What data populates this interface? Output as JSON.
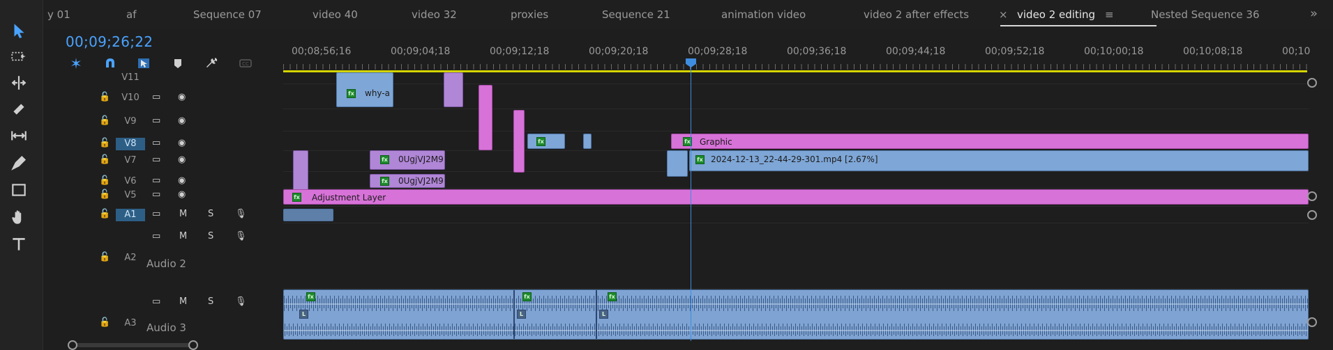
{
  "tabs": [
    {
      "label": "y 01"
    },
    {
      "label": "af"
    },
    {
      "label": "Sequence 07"
    },
    {
      "label": "video 40"
    },
    {
      "label": "video 32"
    },
    {
      "label": "proxies"
    },
    {
      "label": "Sequence 21"
    },
    {
      "label": "animation video"
    },
    {
      "label": "video 2 after effects"
    },
    {
      "label": "video 2 editing",
      "active": true
    },
    {
      "label": "Nested Sequence 36"
    }
  ],
  "active_tab_close": "×",
  "active_tab_menu": "≡",
  "overflow_glyph": "»",
  "timecode": "00;09;26;22",
  "ruler_labels": [
    "00;08;56;16",
    "00;09;04;18",
    "00;09;12;18",
    "00;09;20;18",
    "00;09;28;18",
    "00;09;36;18",
    "00;09;44;18",
    "00;09;52;18",
    "00;10;00;18",
    "00;10;08;18",
    "00;10"
  ],
  "tracks": {
    "v11": {
      "name": "V11"
    },
    "v10": {
      "name": "V10"
    },
    "v9": {
      "name": "V9"
    },
    "v8": {
      "name": "V8"
    },
    "v7": {
      "name": "V7"
    },
    "v6": {
      "name": "V6"
    },
    "v5": {
      "name": "V5"
    },
    "a1": {
      "name": "A1"
    },
    "a2": {
      "name": "A2",
      "label": "Audio 2"
    },
    "a3": {
      "name": "A3",
      "label": "Audio 3"
    }
  },
  "glyphs": {
    "lock": "🔓",
    "mute": "M",
    "solo": "S",
    "fx": "fx",
    "lmark": "L"
  },
  "clips": {
    "why": "why-a",
    "ougj1": "0UgjVJ2M9",
    "ougj2": "0UgjVJ2M9",
    "graphic": "Graphic",
    "mp4": "2024-12-13_22-44-29-301.mp4 [2.67%]",
    "adjustment": "Adjustment Layer"
  },
  "colors": {
    "accent_blue": "#4aa3ff",
    "work_area": "#d4d400",
    "adjustment": "#d772d8",
    "video_clip": "#7ea6d6",
    "purple_clip": "#b086d6",
    "target_track": "#2d5f86"
  },
  "icons": {
    "selection": "selection-arrow-icon",
    "track_select": "track-select-forward-icon",
    "ripple": "ripple-edit-icon",
    "razor": "razor-icon",
    "slip": "slip-icon",
    "pen": "pen-icon",
    "rectangle": "rectangle-icon",
    "hand": "hand-icon",
    "type": "type-icon"
  }
}
